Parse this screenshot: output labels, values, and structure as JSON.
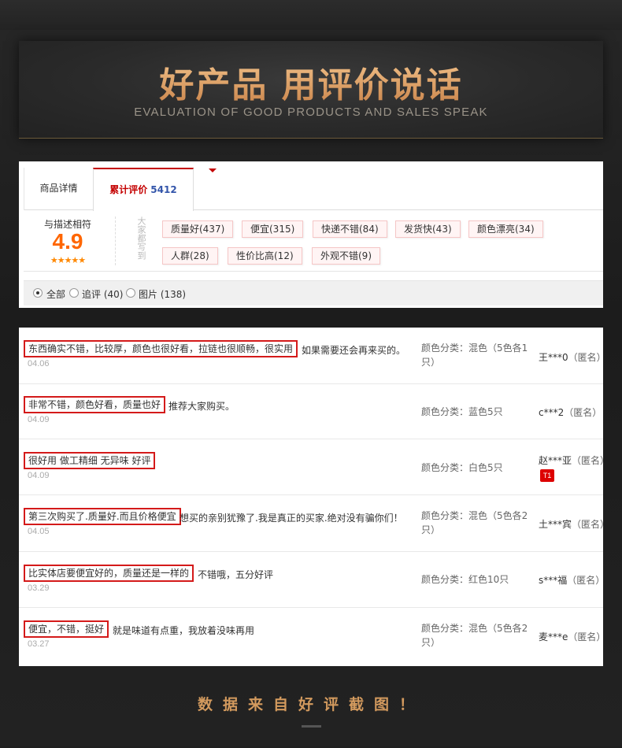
{
  "banner": {
    "title": "好产品 用评价说话",
    "subtitle": "EVALUATION OF GOOD PRODUCTS AND SALES SPEAK"
  },
  "tabs": [
    {
      "label": "商品详情"
    },
    {
      "label": "累计评价",
      "count": "5412"
    }
  ],
  "rating": {
    "label": "与描述相符",
    "score": "4.9",
    "stars": "★★★★★",
    "vertical_label": "大家都写到"
  },
  "tags": [
    "质量好(437)",
    "便宜(315)",
    "快递不错(84)",
    "发货快(43)",
    "颜色漂亮(34)",
    "人群(28)",
    "性价比高(12)",
    "外观不错(9)"
  ],
  "filters": [
    {
      "label": "全部",
      "selected": true
    },
    {
      "label": "追评 (40)",
      "selected": false
    },
    {
      "label": "图片 (138)",
      "selected": false
    }
  ],
  "reviews": [
    {
      "highlight": "东西确实不错，比较厚，颜色也很好看，拉链也很顺畅，很实用",
      "rest": "如果需要还会再来买的。",
      "date": "04.06",
      "sku": "颜色分类：混色（5色各1只）",
      "user": "王***0",
      "anon": "（匿名）"
    },
    {
      "highlight": "非常不错，颜色好看，质量也好",
      "rest": "推荐大家购买。",
      "date": "04.09",
      "sku": "颜色分类：蓝色5只",
      "user": "c***2",
      "anon": "（匿名）"
    },
    {
      "highlight": "很好用 做工精细 无异味 好评",
      "rest": "",
      "date": "04.09",
      "sku": "颜色分类：白色5只",
      "user": "赵***亚",
      "anon": "（匿名）",
      "badge": "T1"
    },
    {
      "highlight": "第三次购买了.质量好.而且价格便宜",
      "rest": "想买的亲别犹豫了.我是真正的买家.绝对没有骗你们！",
      "date": "04.05",
      "sku": "颜色分类：混色（5色各2只）",
      "user": "土***宾",
      "anon": "（匿名）"
    },
    {
      "highlight": "比实体店要便宜好的，质量还是一样的",
      "rest": "不错哦，五分好评",
      "date": "03.29",
      "sku": "颜色分类：红色10只",
      "user": "s***福",
      "anon": "（匿名）"
    },
    {
      "highlight": "便宜，不错，挺好",
      "rest": "就是味道有点重，我放着没味再用",
      "date": "03.27",
      "sku": "颜色分类：混色（5色各2只）",
      "user": "麦***e",
      "anon": "（匿名）"
    }
  ],
  "footer": {
    "text": "数据来自好评截图！"
  }
}
